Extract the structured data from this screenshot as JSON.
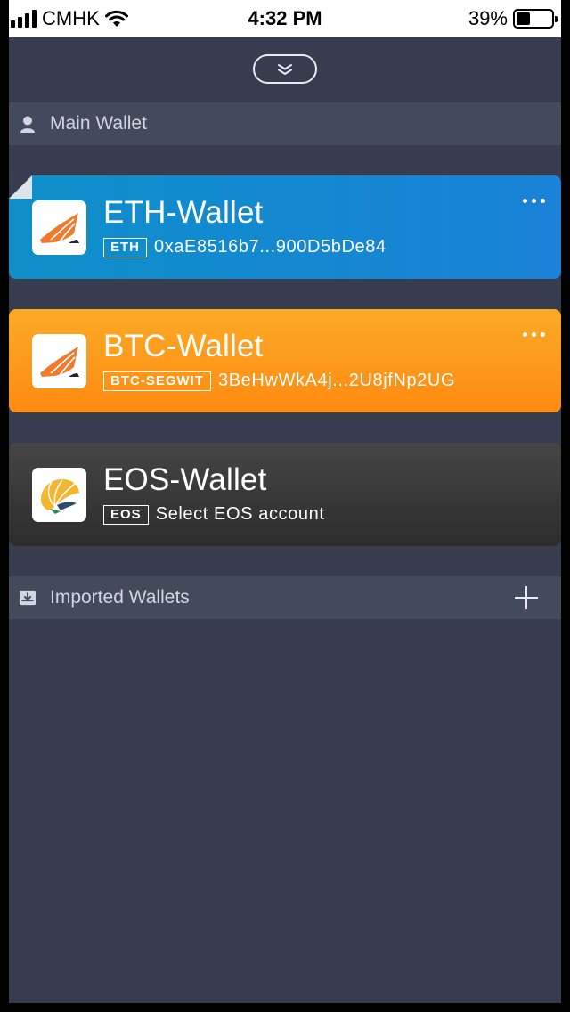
{
  "status_bar": {
    "carrier": "CMHK",
    "time": "4:32 PM",
    "battery": "39%",
    "battery_level": 0.39
  },
  "main_section": {
    "title": "Main Wallet",
    "icon": "user-icon"
  },
  "wallets": [
    {
      "name": "ETH-Wallet",
      "tag": "ETH",
      "address": "0xaE8516b7...900D5bDe84",
      "color_start": "#0e8fc9",
      "color_end": "#1a82d8",
      "icon": "conch-shell-icon",
      "selected": true
    },
    {
      "name": "BTC-Wallet",
      "tag": "BTC-SEGWIT",
      "address": "3BeHwWkA4j...2U8jfNp2UG",
      "color_start": "#fbaa26",
      "color_end": "#ff8a12",
      "icon": "conch-shell-icon"
    },
    {
      "name": "EOS-Wallet",
      "tag": "EOS",
      "address": "Select EOS account",
      "color_start": "#454545",
      "color_end": "#2d2d2d",
      "icon": "eos-shell-icon"
    }
  ],
  "imported_section": {
    "title": "Imported Wallets",
    "icon": "download-tray-icon",
    "add_icon": "plus-icon"
  },
  "colors": {
    "background": "#373d4e",
    "section_header": "#434a5c"
  }
}
